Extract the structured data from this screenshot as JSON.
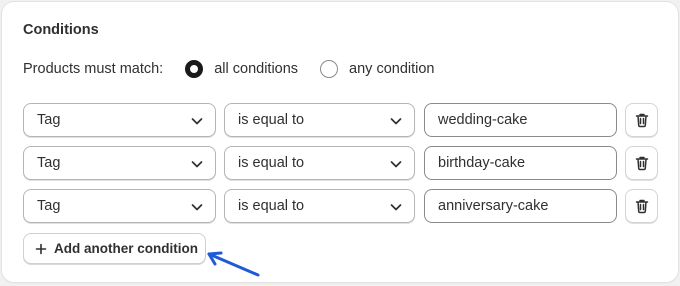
{
  "card": {
    "title": "Conditions"
  },
  "match": {
    "label": "Products must match:",
    "options": [
      {
        "label": "all conditions",
        "checked": true
      },
      {
        "label": "any condition",
        "checked": false
      }
    ]
  },
  "conditions": [
    {
      "field": "Tag",
      "operator": "is equal to",
      "value": "wedding-cake"
    },
    {
      "field": "Tag",
      "operator": "is equal to",
      "value": "birthday-cake"
    },
    {
      "field": "Tag",
      "operator": "is equal to",
      "value": "anniversary-cake"
    }
  ],
  "add_button": {
    "label": "Add another condition",
    "icon": "plus-icon"
  },
  "annotation": {
    "arrow_color": "#1f5bd6",
    "icon": "arrow-icon"
  },
  "icons": {
    "dropdown": "chevron-down-icon",
    "delete": "trash-icon"
  }
}
